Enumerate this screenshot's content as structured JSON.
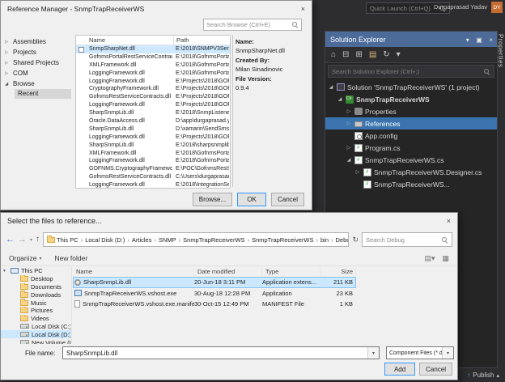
{
  "titlebar": {
    "quick_launch_placeholder": "Quick Launch (Ctrl+Q)",
    "user_name": "Durgaprasad Yadav",
    "avatar_initials": "DY"
  },
  "status_bar": {
    "publish_label": "Publish"
  },
  "right_tab": {
    "label": "Properties"
  },
  "reference_manager": {
    "title": "Reference Manager - SnmpTrapReceiverWS",
    "search_placeholder": "Search Browse (Ctrl+E)",
    "nav": [
      {
        "label": "Assemblies"
      },
      {
        "label": "Projects"
      },
      {
        "label": "Shared Projects"
      },
      {
        "label": "COM"
      },
      {
        "label": "Browse",
        "expanded": true,
        "sub": [
          {
            "label": "Recent",
            "selected": true
          }
        ]
      }
    ],
    "columns": {
      "name": "Name",
      "path": "Path"
    },
    "rows": [
      {
        "name": "SnmpSharpNet.dll",
        "path": "E:\\2018\\SNMPV3Sender\\S",
        "checkbox": true,
        "selected": true
      },
      {
        "name": "GofnmsPortalRestServiceContracts.dll",
        "path": "E:\\2018\\GofnmsPortalRes"
      },
      {
        "name": "XMLFramework.dll",
        "path": "E:\\2018\\GofnmsPortalRes"
      },
      {
        "name": "LoggingFramework.dll",
        "path": "E:\\2018\\GofnmsPortalRes"
      },
      {
        "name": "LoggingFramework.dll",
        "path": "E:\\Projects\\2018\\GOFNM"
      },
      {
        "name": "CryptographyFramework.dll",
        "path": "E:\\Projects\\2018\\GOFNM"
      },
      {
        "name": "GofnmsRestServiceContracts.dll",
        "path": "E:\\Projects\\2018\\GOFNM"
      },
      {
        "name": "LoggingFramework.dll",
        "path": "E:\\Projects\\2018\\GOFNM"
      },
      {
        "name": "SharpSnmpLib.dll",
        "path": "E:\\2018\\SnmpListenerSer"
      },
      {
        "name": "Oracle.DataAccess.dll",
        "path": "D:\\app\\durgaprasad.yada"
      },
      {
        "name": "SharpSnmpLib.dll",
        "path": "D:\\xamarin\\SendSmsServ"
      },
      {
        "name": "LoggingFramework.dll",
        "path": "E:\\Projects\\2018\\GOFNM"
      },
      {
        "name": "SharpSnmpLib.dll",
        "path": "E:\\2018\\sharpsnmplib-mi"
      },
      {
        "name": "XMLFramework.dll",
        "path": "E:\\2018\\GofnmsPortalRes"
      },
      {
        "name": "LoggingFramework.dll",
        "path": "E:\\2018\\GofnmsPortalRes"
      },
      {
        "name": "GOFNMS.CryptographyFramework.dll",
        "path": "E:\\POC\\GofnmsRestServi"
      },
      {
        "name": "GofnmsRestServiceContracts.dll",
        "path": "C:\\Users\\durgaprasad.yad"
      },
      {
        "name": "LoggingFramework.dll",
        "path": "E:\\2018\\IntegrationServ"
      }
    ],
    "info": {
      "name_label": "Name:",
      "name": "SnmpSharpNet.dll",
      "created_by_label": "Created By:",
      "created_by": "Milan Sinadinovic",
      "file_version_label": "File Version:",
      "file_version": "0.9.4"
    },
    "buttons": {
      "browse": "Browse...",
      "ok": "OK",
      "cancel": "Cancel"
    }
  },
  "solution_explorer": {
    "title": "Solution Explorer",
    "search_placeholder": "Search Solution Explorer (Ctrl+;)",
    "tree": [
      {
        "label": "Solution 'SnmpTrapReceiverWS' (1 project)",
        "level": 0,
        "expand": "expanded",
        "icon": "solution"
      },
      {
        "label": "SnmpTrapReceiverWS",
        "level": 1,
        "expand": "expanded",
        "icon": "csproj",
        "bold": true
      },
      {
        "label": "Properties",
        "level": 2,
        "expand": "collapsed",
        "icon": "properties"
      },
      {
        "label": "References",
        "level": 2,
        "expand": "collapsed",
        "icon": "references",
        "selected": true
      },
      {
        "label": "App.config",
        "level": 2,
        "expand": "none",
        "icon": "config"
      },
      {
        "label": "Program.cs",
        "level": 2,
        "expand": "collapsed",
        "icon": "cs"
      },
      {
        "label": "SnmpTrapReceiverWS.cs",
        "level": 2,
        "expand": "expanded",
        "icon": "cs"
      },
      {
        "label": "SnmpTrapReceiverWS.Designer.cs",
        "level": 3,
        "expand": "collapsed",
        "icon": "cs"
      },
      {
        "label": "SnmpTrapReceiverWS...",
        "level": 3,
        "expand": "none",
        "icon": "cs"
      }
    ]
  },
  "file_dialog": {
    "title": "Select the files to reference...",
    "breadcrumb": [
      "This PC",
      "Local Disk (D:)",
      "Articles",
      "SNMP",
      "SnmpTrapReceiverWS",
      "SnmpTrapReceiverWS",
      "bin",
      "Debug"
    ],
    "search_placeholder": "Search Debug",
    "toolbar": {
      "organize": "Organize",
      "new_folder": "New folder"
    },
    "sidebar": [
      {
        "label": "This PC",
        "icon": "pc",
        "level": 0,
        "expanded": true
      },
      {
        "label": "Desktop",
        "icon": "folder",
        "level": 1
      },
      {
        "label": "Documents",
        "icon": "folder",
        "level": 1
      },
      {
        "label": "Downloads",
        "icon": "folder",
        "level": 1
      },
      {
        "label": "Music",
        "icon": "folder",
        "level": 1
      },
      {
        "label": "Pictures",
        "icon": "folder",
        "level": 1
      },
      {
        "label": "Videos",
        "icon": "folder",
        "level": 1
      },
      {
        "label": "Local Disk (C:)",
        "icon": "drive",
        "level": 1
      },
      {
        "label": "Local Disk (D:)",
        "icon": "drive",
        "level": 1,
        "selected": true
      },
      {
        "label": "New Volume (E",
        "icon": "drive",
        "level": 1
      }
    ],
    "columns": [
      "Name",
      "Date modified",
      "Type",
      "Size"
    ],
    "files": [
      {
        "name": "SharpSnmpLib.dll",
        "date": "20-Jun-18 3:11 PM",
        "type": "Application extens...",
        "size": "211 KB",
        "icon": "dll",
        "selected": true
      },
      {
        "name": "SnmpTrapReceiverWS.vshost.exe",
        "date": "30-Aug-18 12:28 PM",
        "type": "Application",
        "size": "23 KB",
        "icon": "app"
      },
      {
        "name": "SnmpTrapReceiverWS.vshost.exe.manifest",
        "date": "30-Oct-15 12:49 PM",
        "type": "MANIFEST File",
        "size": "1 KB",
        "icon": "page"
      }
    ],
    "file_name_label": "File name:",
    "file_name_value": "SharpSnmpLib.dll",
    "filter_value": "Component Files (*.dll;*.tlb;*.ol",
    "buttons": {
      "add": "Add",
      "cancel": "Cancel"
    }
  }
}
